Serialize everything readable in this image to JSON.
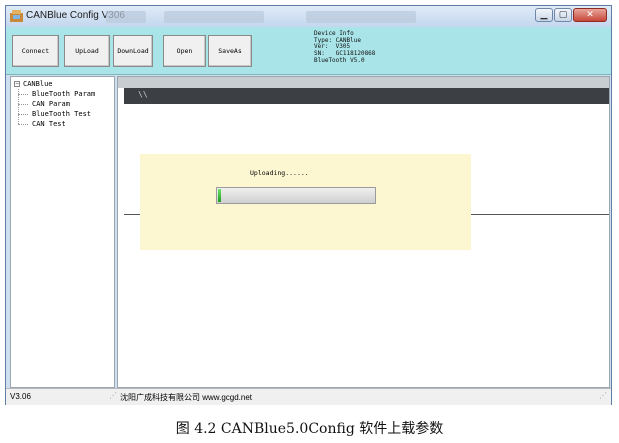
{
  "window": {
    "title": "CANBlue Config V306",
    "controls": {
      "minimize_icon": "minimize-icon",
      "maximize_icon": "maximize-icon",
      "close_icon": "close-icon"
    }
  },
  "toolbar": {
    "buttons": [
      {
        "label": "Connect"
      },
      {
        "label": "UpLoad"
      },
      {
        "label": "DownLoad"
      },
      {
        "label": "Open"
      },
      {
        "label": "SaveAs"
      }
    ],
    "background": "#a9e4e8"
  },
  "device_info": {
    "heading": "Device Info",
    "type": "Type: CANBlue",
    "ver": "Ver:  V305",
    "sn": "SN:   GC118120868",
    "bluetooth": "BlueTooth V5.0"
  },
  "tree": {
    "root": "CANBlue",
    "expander": "−",
    "items": [
      {
        "label": "BlueTooth Param"
      },
      {
        "label": "CAN Param"
      },
      {
        "label": "BlueTooth Test"
      },
      {
        "label": "CAN Test"
      }
    ]
  },
  "content": {
    "tab_text": "\\\\",
    "upload_dialog": {
      "status": "Uploading......",
      "progress": 0.02,
      "bar_color": "#1aa01a"
    }
  },
  "statusbar": {
    "version": "V3.06",
    "company": "沈阳广成科技有限公司  www.gcgd.net"
  },
  "caption": "图 4.2 CANBlue5.0Config 软件上载参数"
}
